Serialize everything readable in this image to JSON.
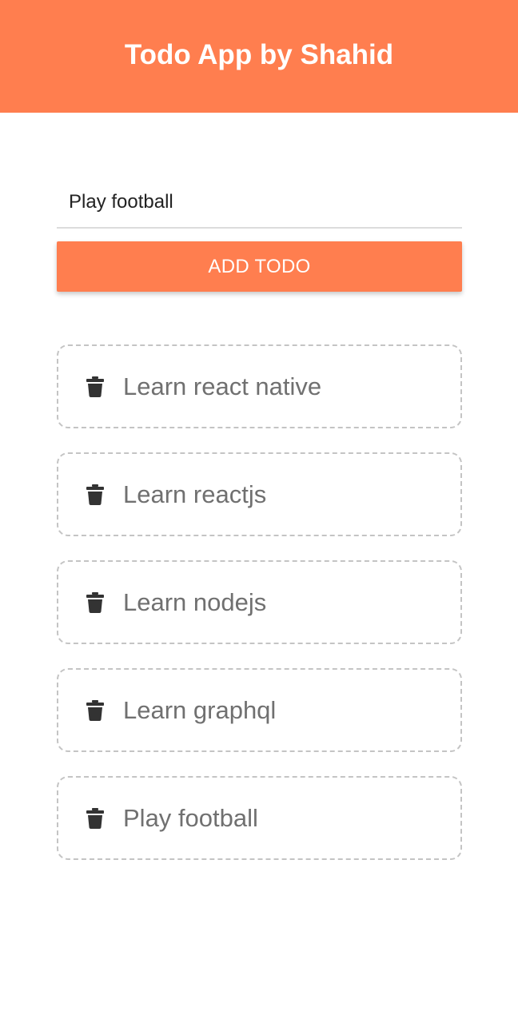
{
  "header": {
    "title": "Todo App by Shahid",
    "background": "#ff7e4f"
  },
  "form": {
    "input_value": "Play football",
    "add_label": "ADD TODO"
  },
  "todos": [
    {
      "text": "Learn react native",
      "icon": "trash-icon"
    },
    {
      "text": "Learn reactjs",
      "icon": "trash-icon"
    },
    {
      "text": "Learn nodejs",
      "icon": "trash-icon"
    },
    {
      "text": "Learn graphql",
      "icon": "trash-icon"
    },
    {
      "text": "Play football",
      "icon": "trash-icon"
    }
  ]
}
